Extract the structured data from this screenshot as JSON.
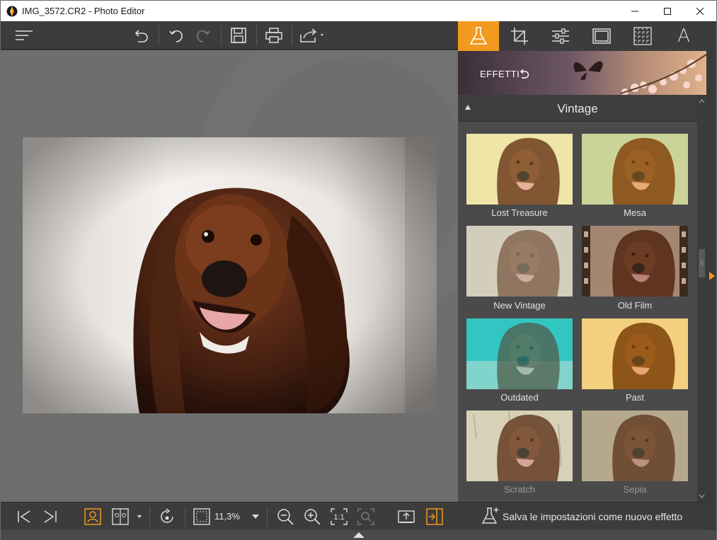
{
  "window": {
    "title": "IMG_3572.CR2 - Photo Editor"
  },
  "toolbar": {
    "menu_icon": "hamburger-icon",
    "undo_all_icon": "undo-icon",
    "undo_icon": "undo-arrow-icon",
    "redo_icon": "redo-arrow-icon",
    "save_icon": "floppy-disk-icon",
    "print_icon": "printer-icon",
    "share_icon": "share-icon"
  },
  "right_tabs": [
    {
      "name": "effects",
      "icon": "flask-icon",
      "active": true
    },
    {
      "name": "crop",
      "icon": "crop-icon",
      "active": false
    },
    {
      "name": "adjust",
      "icon": "sliders-icon",
      "active": false
    },
    {
      "name": "frame",
      "icon": "frame-icon",
      "active": false
    },
    {
      "name": "texture",
      "icon": "texture-icon",
      "active": false
    },
    {
      "name": "text",
      "icon": "text-icon",
      "active": false,
      "glyph": "A"
    }
  ],
  "banner": {
    "label": "EFFETTI"
  },
  "section": {
    "title": "Vintage"
  },
  "effects": [
    {
      "label": "Lost Treasure"
    },
    {
      "label": "Mesa"
    },
    {
      "label": "New Vintage"
    },
    {
      "label": "Old Film"
    },
    {
      "label": "Outdated"
    },
    {
      "label": "Past"
    },
    {
      "label": "Scratch"
    },
    {
      "label": "Sepia"
    }
  ],
  "bottom": {
    "zoom": "11,3%"
  },
  "save_effect": {
    "label": "Salva le impostazioni come nuovo effetto"
  },
  "colors": {
    "accent": "#f29a1f",
    "panel": "#3c3c3c",
    "canvas": "#6e6e6e"
  }
}
